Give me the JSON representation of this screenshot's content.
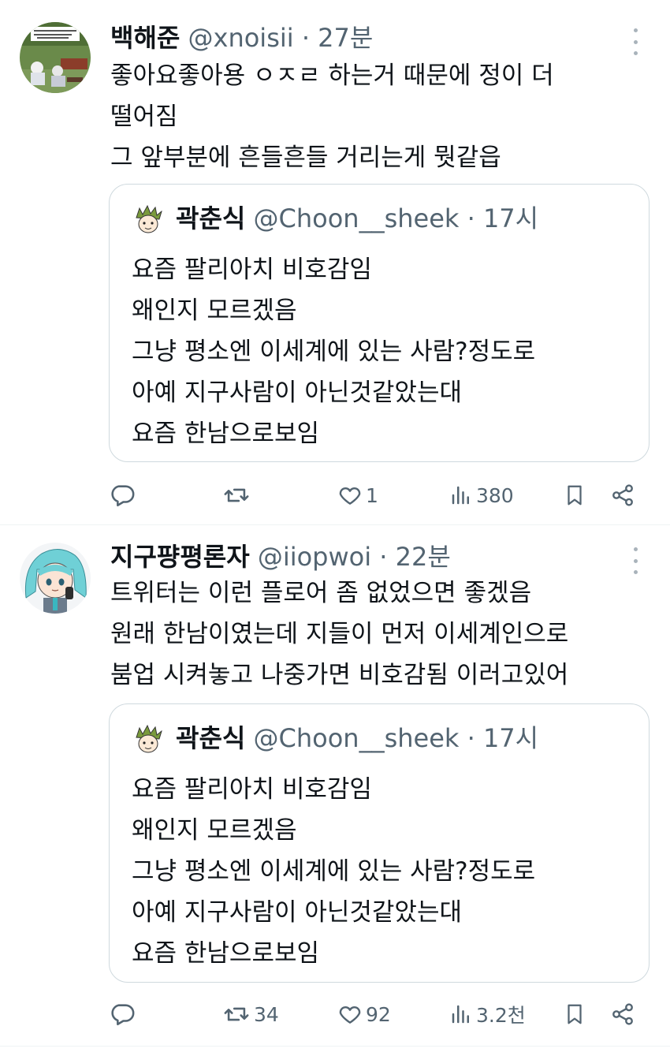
{
  "tweets": [
    {
      "name": "백해준",
      "handle": "@xnoisii",
      "dot": "·",
      "time": "27분",
      "avatar_icon": "game-screenshot-avatar",
      "lines": [
        "좋아요좋아용 ㅇㅈㄹ 하는거 때문에 정이 더",
        "떨어짐",
        "그 앞부분에 흔들흔들 거리는게 뭣같읍"
      ],
      "quote": {
        "name": "곽춘식",
        "handle": "@Choon__sheek",
        "dot": "·",
        "time": "17시",
        "avatar_icon": "sketch-character-avatar",
        "lines": [
          "요즘 팔리아치 비호감임",
          "왜인지 모르겠음",
          "그냥 평소엔 이세계에 있는 사람?정도로",
          "아예 지구사람이 아닌것같았는대",
          "요즘 한남으로보임"
        ]
      },
      "actions": {
        "reply": "",
        "retweet": "",
        "like": "1",
        "views": "380"
      }
    },
    {
      "name": "지구퍙평론자",
      "handle": "@iiopwoi",
      "dot": "·",
      "time": "22분",
      "avatar_icon": "anime-character-avatar",
      "lines": [
        "트위터는 이런 플로어 좀 없었으면 좋겠음",
        "원래 한남이였는데 지들이 먼저 이세계인으로",
        "붐업 시켜놓고 나중가면 비호감됨 이러고있어"
      ],
      "quote": {
        "name": "곽춘식",
        "handle": "@Choon__sheek",
        "dot": "·",
        "time": "17시",
        "avatar_icon": "sketch-character-avatar",
        "lines": [
          "요즘 팔리아치 비호감임",
          "왜인지 모르겠음",
          "그냥 평소엔 이세계에 있는 사람?정도로",
          "아예 지구사람이 아닌것같았는대",
          "요즘 한남으로보임"
        ]
      },
      "actions": {
        "reply": "",
        "retweet": "34",
        "like": "92",
        "views": "3.2천"
      }
    }
  ],
  "colors": {
    "text": "#0f1419",
    "secondary": "#536471",
    "border": "#cfd9de",
    "divider": "#eff3f4"
  }
}
